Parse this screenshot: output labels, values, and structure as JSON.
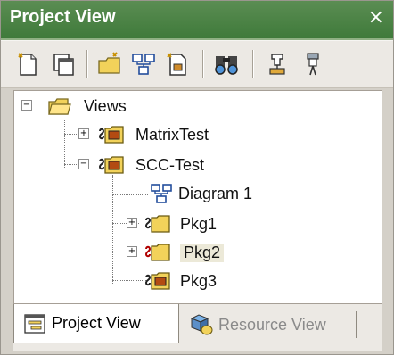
{
  "window": {
    "title": "Project View",
    "close_glyph": "×"
  },
  "toolbar": {
    "buttons": [
      {
        "icon": "new-document-icon"
      },
      {
        "icon": "copy-windows-icon"
      },
      {
        "icon": "new-folder-icon"
      },
      {
        "icon": "diagram-icon"
      },
      {
        "icon": "new-file-icon"
      },
      {
        "icon": "find-icon"
      },
      {
        "icon": "properties-icon"
      },
      {
        "icon": "tool-icon"
      }
    ]
  },
  "tree": {
    "items": [
      {
        "label": "Views"
      },
      {
        "label": "MatrixTest"
      },
      {
        "label": "SCC-Test"
      },
      {
        "label": "Diagram 1"
      },
      {
        "label": "Pkg1"
      },
      {
        "label": "Pkg2"
      },
      {
        "label": "Pkg3"
      }
    ]
  },
  "tabs": [
    {
      "label": "Project View"
    },
    {
      "label": "Resource View"
    }
  ],
  "colors": {
    "titlebar": "#3f7a3a",
    "folder": "#f2d25a",
    "selection": "#ece9d8"
  }
}
